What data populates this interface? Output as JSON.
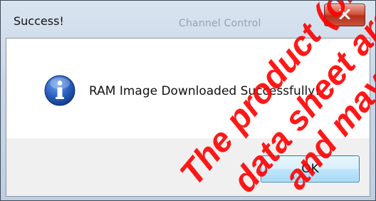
{
  "window": {
    "title": "Success!",
    "background_title": "Channel Control"
  },
  "dialog": {
    "icon": "info-icon",
    "message": "RAM Image Downloaded Successfully!",
    "ok_label": "OK",
    "close_icon": "close-icon"
  },
  "watermark": {
    "lines": [
      "The product (or",
      "data sheet are",
      "and may no"
    ],
    "color": "#ff0000"
  },
  "colors": {
    "close_button": "#c94a33",
    "ok_button_border": "#3c7fb1",
    "info_icon": "#1f57b5"
  }
}
